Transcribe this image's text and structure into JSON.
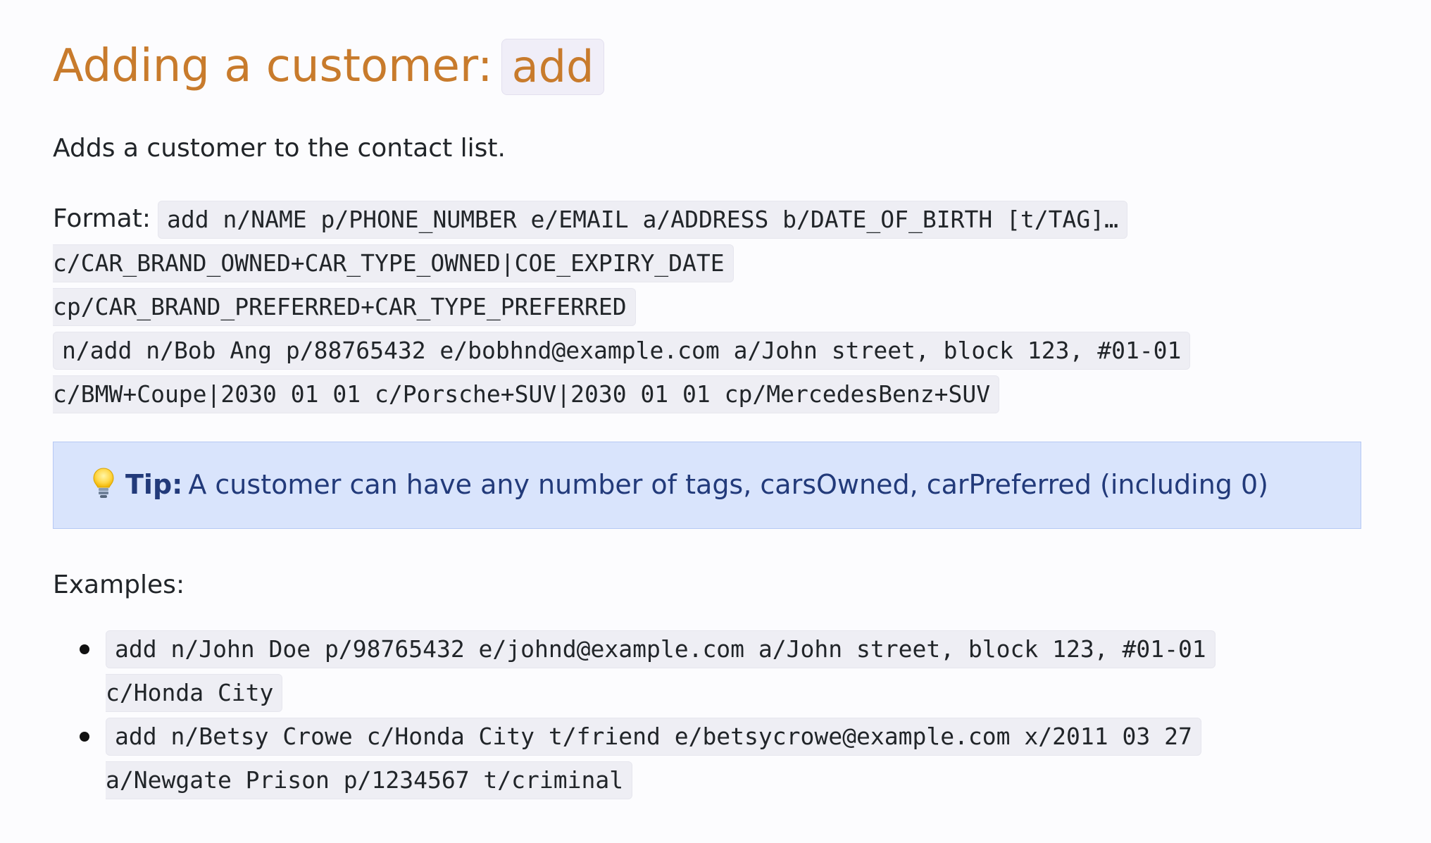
{
  "heading": {
    "text": "Adding a customer:",
    "command": "add"
  },
  "description": "Adds a customer to the contact list.",
  "format": {
    "label": "Format:",
    "lines": [
      "add n/NAME p/PHONE_NUMBER e/EMAIL a/ADDRESS b/DATE_OF_BIRTH [t/TAG]…",
      "c/CAR_BRAND_OWNED+CAR_TYPE_OWNED|COE_EXPIRY_DATE",
      "cp/CAR_BRAND_PREFERRED+CAR_TYPE_PREFERRED",
      "n/add n/Bob Ang p/88765432 e/bobhnd@example.com a/John street, block 123, #01-01",
      "c/BMW+Coupe|2030 01 01 c/Porsche+SUV|2030 01 01 cp/MercedesBenz+SUV"
    ]
  },
  "tip": {
    "icon": "lightbulb-icon",
    "label": "Tip:",
    "text": "A customer can have any number of tags, carsOwned, carPreferred (including 0)"
  },
  "examples": {
    "label": "Examples:",
    "items": [
      {
        "line1": "add n/John Doe p/98765432 e/johnd@example.com a/John street, block 123, #01-01",
        "line2": "c/Honda City"
      },
      {
        "line1": "add n/Betsy Crowe c/Honda City t/friend e/betsycrowe@example.com x/2011 03 27",
        "line2": "a/Newgate Prison p/1234567 t/criminal"
      }
    ]
  },
  "colors": {
    "heading": "#c87b2c",
    "tip_background": "#d9e4fc",
    "tip_text": "#223a7a",
    "code_background": "#eeeef4"
  }
}
